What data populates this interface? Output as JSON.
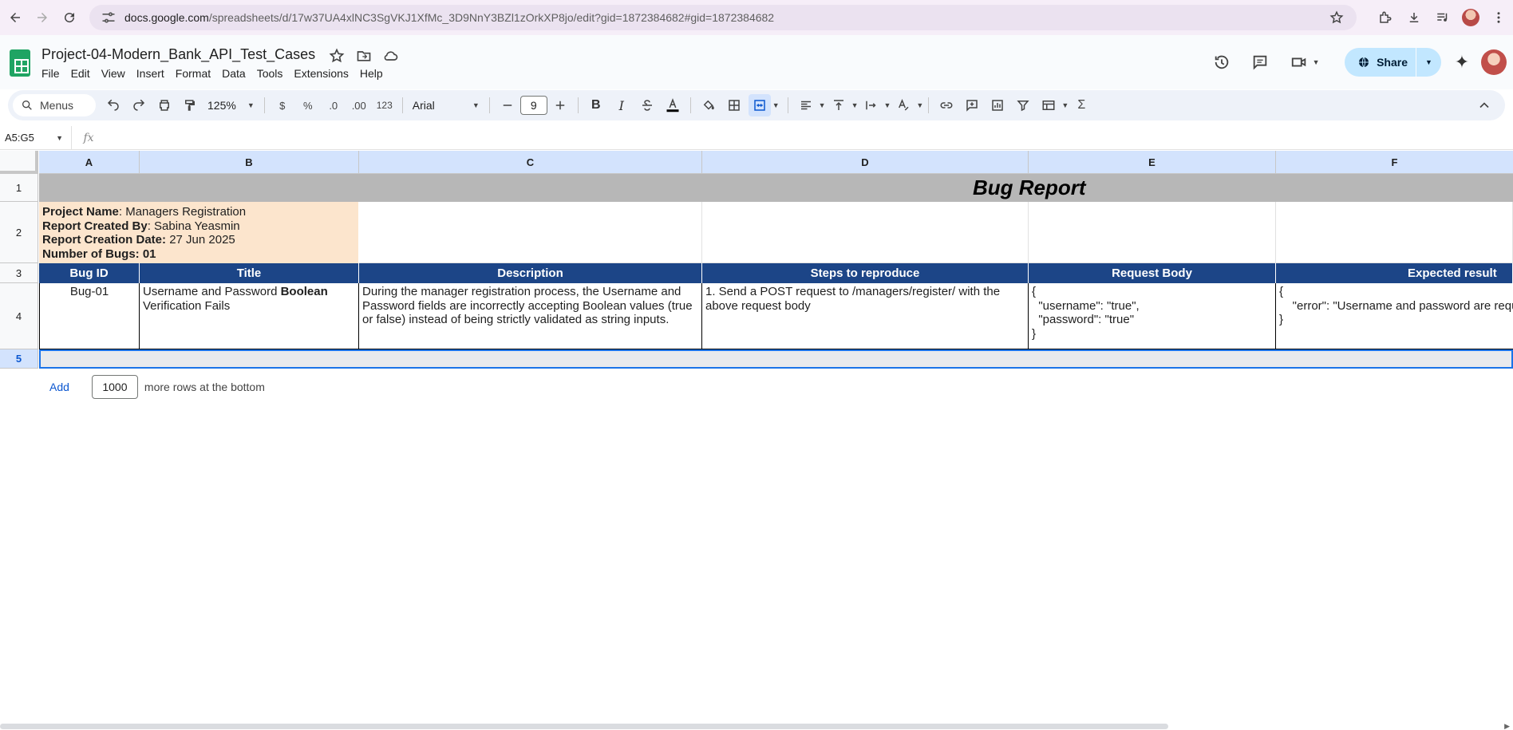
{
  "browser": {
    "url_host": "docs.google.com",
    "url_path": "/spreadsheets/d/17w37UA4xlNC3SgVKJ1XfMc_3D9NnY3BZl1zOrkXP8jo/edit?gid=1872384682#gid=1872384682"
  },
  "doc": {
    "title": "Project-04-Modern_Bank_API_Test_Cases",
    "menus": [
      "File",
      "Edit",
      "View",
      "Insert",
      "Format",
      "Data",
      "Tools",
      "Extensions",
      "Help"
    ],
    "share_label": "Share"
  },
  "toolbar": {
    "search_label": "Menus",
    "zoom": "125%",
    "currency": "$",
    "percent": "%",
    "decrease_decimal": ".0",
    "increase_decimal": ".00",
    "number_format": "123",
    "font": "Arial",
    "font_size": "9",
    "bold": "B",
    "italic": "I",
    "sum": "Σ"
  },
  "formula_bar": {
    "name_box": "A5:G5",
    "fx": "fx"
  },
  "grid": {
    "columns": [
      "A",
      "B",
      "C",
      "D",
      "E",
      "F"
    ],
    "rows": [
      "1",
      "2",
      "3",
      "4",
      "5"
    ],
    "title": "Bug Report",
    "info": {
      "project_name_label": "Project Name",
      "project_name": ": Managers Registration",
      "created_by_label": "Report Created By",
      "created_by": ":  Sabina Yeasmin",
      "creation_date_label": "Report Creation Date:",
      "creation_date": " 27 Jun 2025",
      "bugs_label": "Number of Bugs: 01"
    },
    "headers": [
      "Bug ID",
      "Title",
      "Description",
      "Steps to reproduce",
      "Request Body",
      "Expected result"
    ],
    "row4": {
      "bug_id": "Bug-01",
      "title_plain": "Username and Password ",
      "title_bold": "Boolean",
      "title_rest": "Verification Fails",
      "description": "During the manager registration process, the Username and Password fields are incorrectly accepting Boolean values (true or false) instead of being strictly validated as string inputs.",
      "steps": "1. Send a POST request to /managers/register/ with the above request body",
      "request_body": "{\n  \"username\": \"true\",\n  \"password\": \"true\"\n}",
      "expected": "{\n    \"error\": \"Username and password are requ\n}"
    }
  },
  "add_rows": {
    "add_label": "Add",
    "count": "1000",
    "suffix": "more rows at the bottom"
  }
}
